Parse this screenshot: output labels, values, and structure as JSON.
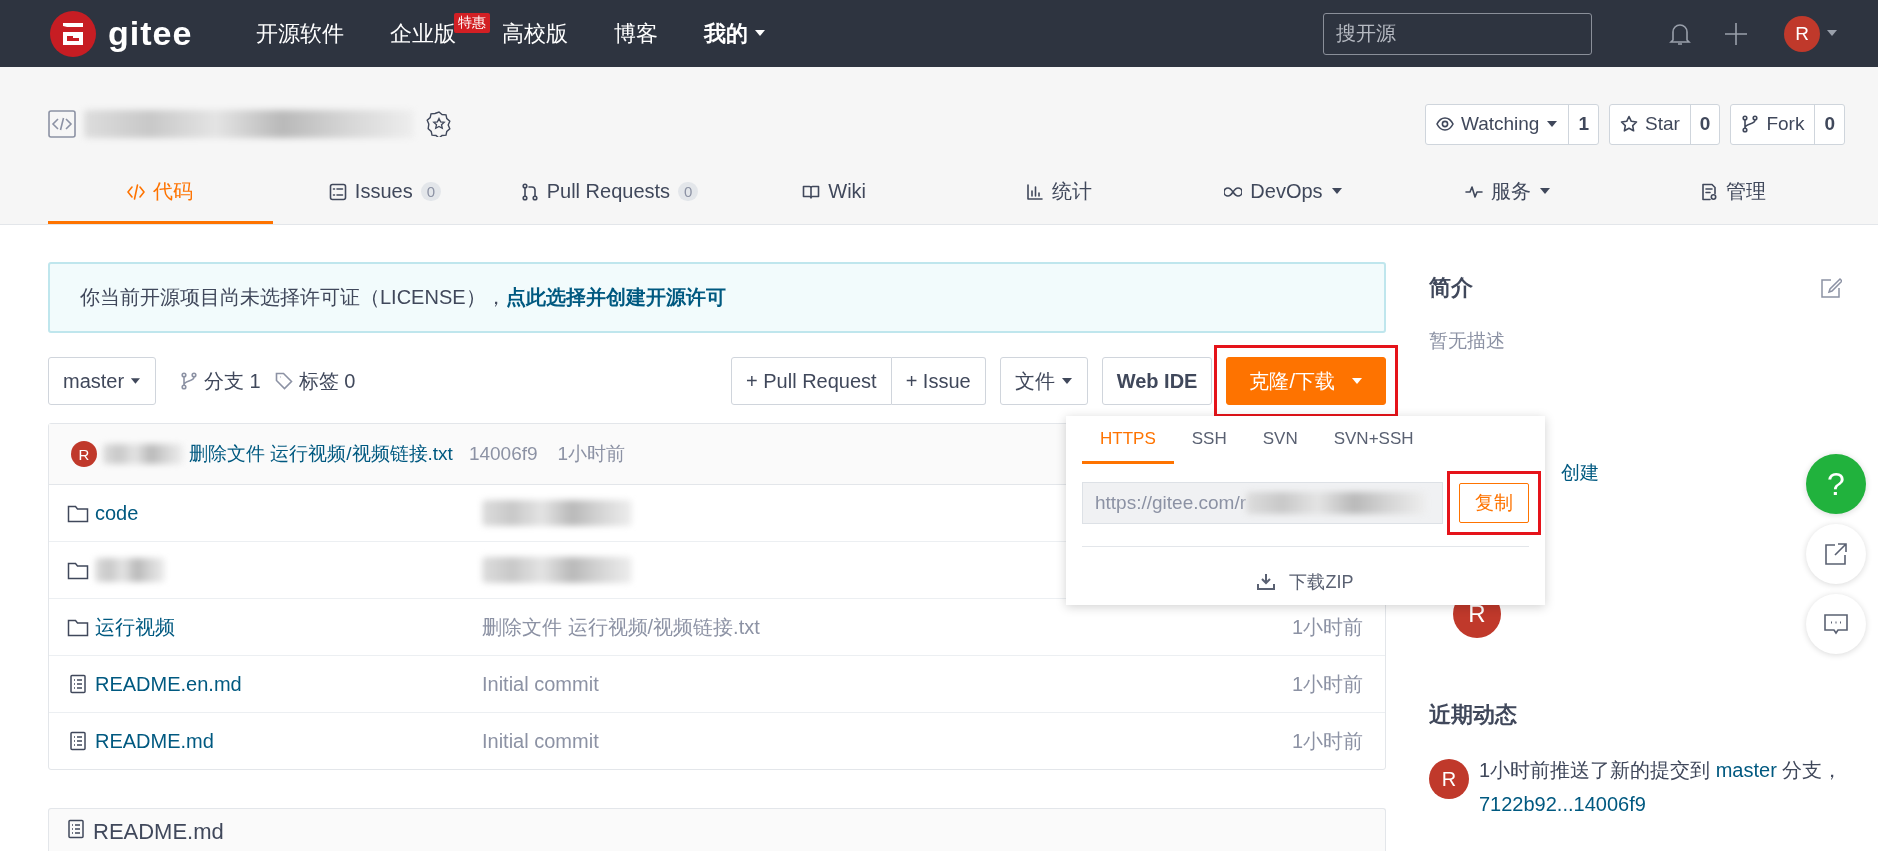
{
  "header": {
    "logo": "gitee",
    "nav": [
      {
        "label": "开源软件",
        "bold": false
      },
      {
        "label": "企业版",
        "badge": "特惠",
        "bold": false
      },
      {
        "label": "高校版",
        "bold": false
      },
      {
        "label": "博客",
        "bold": false
      },
      {
        "label": "我的",
        "dropdown": true,
        "bold": true
      }
    ],
    "search": {
      "placeholder": "搜开源"
    },
    "avatar": "R"
  },
  "repo": {
    "name_redacted": true,
    "actions": [
      {
        "label": "Watching",
        "dropdown": true,
        "count": "1"
      },
      {
        "label": "Star",
        "dropdown": false,
        "count": "0"
      },
      {
        "label": "Fork",
        "dropdown": false,
        "count": "0"
      }
    ],
    "tabs": [
      {
        "label": "代码",
        "selected": true
      },
      {
        "label": "Issues",
        "count": "0",
        "selected": false
      },
      {
        "label": "Pull Requests",
        "count": "0",
        "selected": false
      },
      {
        "label": "Wiki",
        "selected": false
      },
      {
        "label": "统计",
        "selected": false
      },
      {
        "label": "DevOps",
        "dropdown": true,
        "selected": false
      },
      {
        "label": "服务",
        "dropdown": true,
        "selected": false
      },
      {
        "label": "管理",
        "selected": false
      }
    ]
  },
  "license_notice": {
    "text": "你当前开源项目尚未选择许可证（LICENSE），",
    "link": "点此选择并创建开源许可"
  },
  "toolbar": {
    "branch": "master",
    "branches": "分支 1",
    "tags": "标签 0",
    "buttons": [
      {
        "kind": "group",
        "labels": [
          "+ Pull Request",
          "+ Issue"
        ]
      },
      {
        "kind": "dropdown",
        "label": "文件"
      },
      {
        "kind": "plain",
        "label": "Web IDE"
      },
      {
        "kind": "primary",
        "label": "克隆/下载",
        "highlighted": true
      }
    ]
  },
  "last_commit": {
    "avatar": "R",
    "author_redacted": true,
    "message": "删除文件 运行视频/视频链接.txt",
    "hash": "14006f9",
    "time": "1小时前"
  },
  "files": [
    {
      "kind": "folder",
      "name": "code",
      "name_redacted": false,
      "message_redacted": true
    },
    {
      "kind": "folder",
      "name_redacted": true,
      "message_redacted": true
    },
    {
      "kind": "folder",
      "name": "运行视频",
      "name_redacted": false,
      "message_redacted": false,
      "message": "删除文件 运行视频/视频链接.txt",
      "time": "1小时前"
    },
    {
      "kind": "file",
      "name": "README.en.md",
      "name_redacted": false,
      "message_redacted": false,
      "message": "Initial commit",
      "time": "1小时前"
    },
    {
      "kind": "file",
      "name": "README.md",
      "name_redacted": false,
      "message_redacted": false,
      "message": "Initial commit",
      "time": "1小时前"
    }
  ],
  "readme": {
    "title": "README.md"
  },
  "clone_popup": {
    "tabs": [
      {
        "label": "HTTPS",
        "selected": true
      },
      {
        "label": "SSH",
        "selected": false
      },
      {
        "label": "SVN",
        "selected": false
      },
      {
        "label": "SVN+SSH",
        "selected": false
      }
    ],
    "url": "https://gitee.com/r",
    "url_redacted": true,
    "copy": {
      "label": "复制",
      "highlighted": true
    },
    "download": "下载ZIP"
  },
  "sidebar": {
    "intro_title": "简介",
    "intro_text": "暂无描述",
    "release_fragment": "创建",
    "contributor_avatar": "R",
    "recent_title": "近期动态",
    "activity": [
      {
        "avatar": "R",
        "parts": [
          {
            "text": "1小时前推送了新的提交到 ",
            "link": false
          },
          {
            "text": "master",
            "link": true
          },
          {
            "text": " 分支，",
            "link": false
          },
          {
            "text": "7122b92...14006f9",
            "link": true
          }
        ]
      }
    ]
  },
  "float_buttons": [
    {
      "kind": "help",
      "label": "?"
    },
    {
      "kind": "share"
    },
    {
      "kind": "comment"
    }
  ]
}
